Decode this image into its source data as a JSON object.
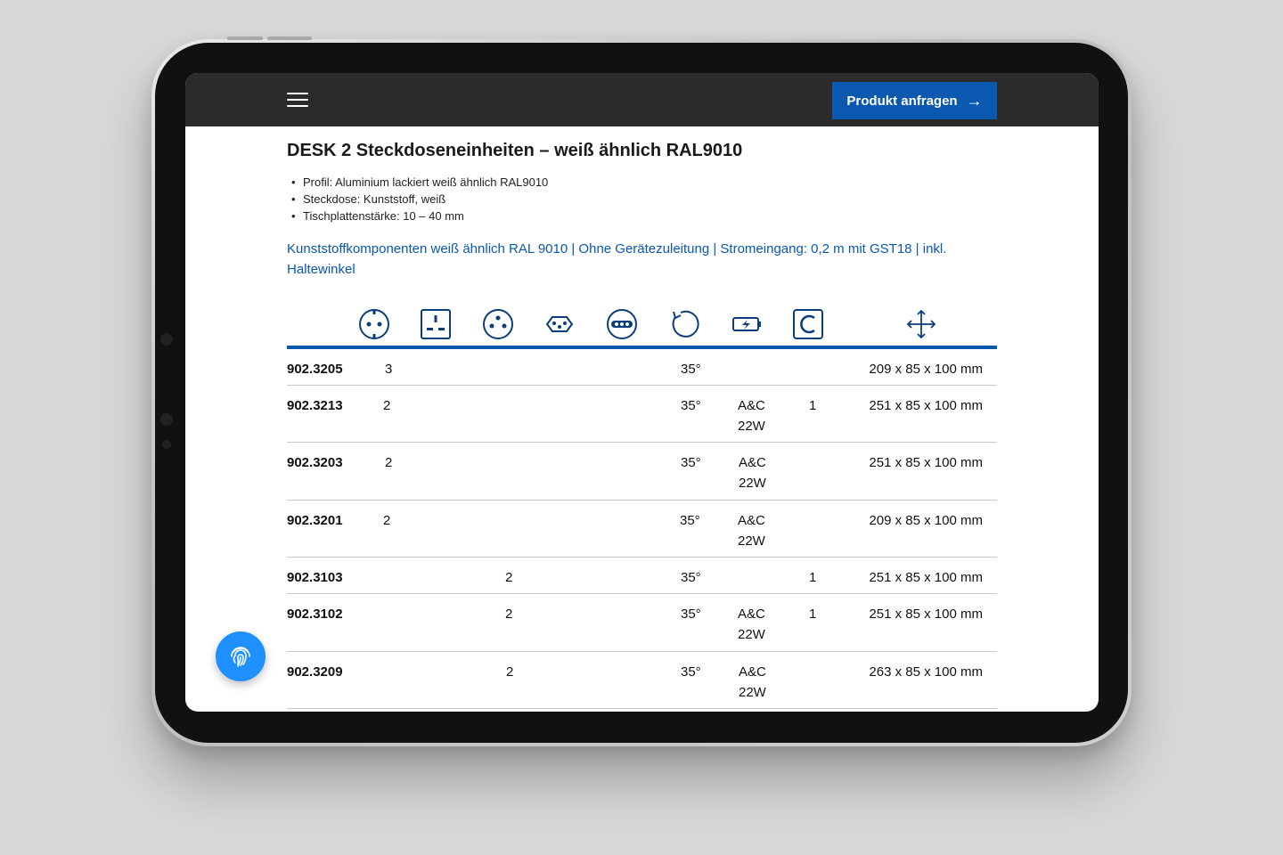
{
  "header": {
    "cta_label": "Produkt anfragen",
    "cta_arrow": "→"
  },
  "product": {
    "title": "DESK 2 Steckdoseneinheiten – weiß ähnlich RAL9010",
    "specs": [
      "Profil: Aluminium lackiert weiß ähnlich RAL9010",
      "Steckdose: Kunststoff, weiß",
      "Tischplattenstärke: 10 – 40 mm"
    ],
    "subline": "Kunststoffkomponenten weiß ähnlich RAL 9010 | Ohne Gerätezuleitung | Stromeingang: 0,2 m mit GST18 | inkl. Haltewinkel"
  },
  "table": {
    "icons": [
      "schuko-socket-icon",
      "uk-socket-icon",
      "french-socket-icon",
      "swiss-socket-icon",
      "euro-socket-icon",
      "rotation-icon",
      "usb-charger-icon",
      "usb-c-icon",
      "dimensions-icon"
    ],
    "rows": [
      {
        "art": "902.3205",
        "schuko": "3",
        "uk": "",
        "fr": "",
        "angle": "35°",
        "usb_1": "",
        "usb_2": "",
        "usbc": "",
        "dim": "209 x 85 x 100 mm"
      },
      {
        "art": "902.3213",
        "schuko": "2",
        "uk": "",
        "fr": "",
        "angle": "35°",
        "usb_1": "A&C",
        "usb_2": "22W",
        "usbc": "1",
        "dim": "251 x 85 x 100 mm"
      },
      {
        "art": "902.3203",
        "schuko": "2",
        "uk": "",
        "fr": "",
        "angle": "35°",
        "usb_1": "A&C",
        "usb_2": "22W",
        "usbc": "",
        "dim": "251 x 85 x 100 mm"
      },
      {
        "art": "902.3201",
        "schuko": "2",
        "uk": "",
        "fr": "",
        "angle": "35°",
        "usb_1": "A&C",
        "usb_2": "22W",
        "usbc": "",
        "dim": "209 x 85 x 100 mm"
      },
      {
        "art": "902.3103",
        "schuko": "",
        "uk": "",
        "fr": "2",
        "angle": "35°",
        "usb_1": "",
        "usb_2": "",
        "usbc": "1",
        "dim": "251 x 85 x 100 mm"
      },
      {
        "art": "902.3102",
        "schuko": "",
        "uk": "",
        "fr": "2",
        "angle": "35°",
        "usb_1": "A&C",
        "usb_2": "22W",
        "usbc": "1",
        "dim": "251 x 85 x 100 mm"
      },
      {
        "art": "902.3209",
        "schuko": "",
        "uk": "",
        "fr": "2",
        "angle": "35°",
        "usb_1": "A&C",
        "usb_2": "22W",
        "usbc": "",
        "dim": "263 x 85 x 100 mm"
      }
    ]
  },
  "colors": {
    "accent": "#0a58b0",
    "topbar": "#2b2b2b",
    "fab": "#1e90ff"
  }
}
